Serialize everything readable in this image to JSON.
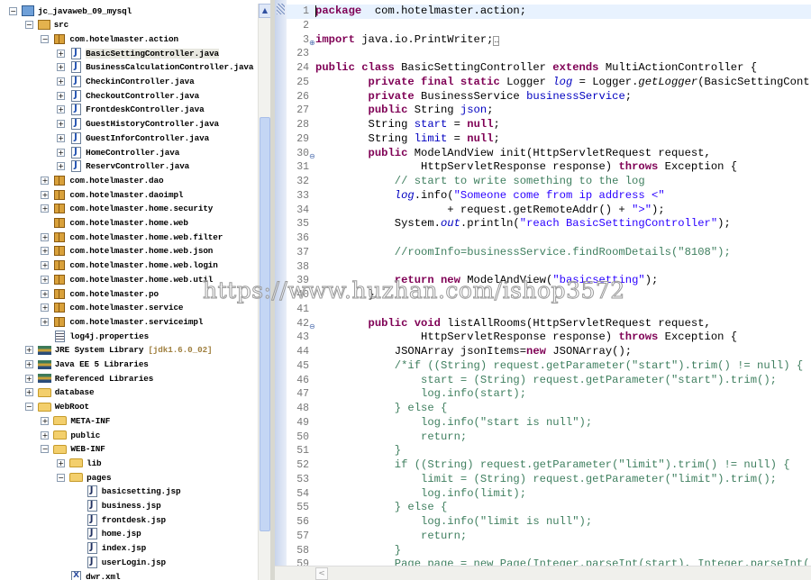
{
  "package_explorer": {
    "items": [
      {
        "level": 0,
        "expander": "-",
        "icon": "proj",
        "label": "jc_javaweb_09_mysql"
      },
      {
        "level": 1,
        "expander": "-",
        "icon": "src",
        "label": "src"
      },
      {
        "level": 2,
        "expander": "-",
        "icon": "pkg",
        "label": "com.hotelmaster.action"
      },
      {
        "level": 3,
        "expander": "+",
        "icon": "java",
        "label": "BasicSettingController.java",
        "selected": true
      },
      {
        "level": 3,
        "expander": "+",
        "icon": "java",
        "label": "BusinessCalculationController.java"
      },
      {
        "level": 3,
        "expander": "+",
        "icon": "java",
        "label": "CheckinController.java"
      },
      {
        "level": 3,
        "expander": "+",
        "icon": "java",
        "label": "CheckoutController.java"
      },
      {
        "level": 3,
        "expander": "+",
        "icon": "java",
        "label": "FrontdeskController.java"
      },
      {
        "level": 3,
        "expander": "+",
        "icon": "java",
        "label": "GuestHistoryController.java"
      },
      {
        "level": 3,
        "expander": "+",
        "icon": "java",
        "label": "GuestInforController.java"
      },
      {
        "level": 3,
        "expander": "+",
        "icon": "java",
        "label": "HomeController.java"
      },
      {
        "level": 3,
        "expander": "+",
        "icon": "java",
        "label": "ReservController.java"
      },
      {
        "level": 2,
        "expander": "+",
        "icon": "pkg",
        "label": "com.hotelmaster.dao"
      },
      {
        "level": 2,
        "expander": "+",
        "icon": "pkg",
        "label": "com.hotelmaster.daoimpl"
      },
      {
        "level": 2,
        "expander": "+",
        "icon": "pkg",
        "label": "com.hotelmaster.home.security"
      },
      {
        "level": 2,
        "expander": "",
        "icon": "pkg",
        "label": "com.hotelmaster.home.web"
      },
      {
        "level": 2,
        "expander": "+",
        "icon": "pkg",
        "label": "com.hotelmaster.home.web.filter"
      },
      {
        "level": 2,
        "expander": "+",
        "icon": "pkg",
        "label": "com.hotelmaster.home.web.json"
      },
      {
        "level": 2,
        "expander": "+",
        "icon": "pkg",
        "label": "com.hotelmaster.home.web.login"
      },
      {
        "level": 2,
        "expander": "+",
        "icon": "pkg",
        "label": "com.hotelmaster.home.web.util"
      },
      {
        "level": 2,
        "expander": "+",
        "icon": "pkg",
        "label": "com.hotelmaster.po"
      },
      {
        "level": 2,
        "expander": "+",
        "icon": "pkg",
        "label": "com.hotelmaster.service"
      },
      {
        "level": 2,
        "expander": "+",
        "icon": "pkg",
        "label": "com.hotelmaster.serviceimpl"
      },
      {
        "level": 2,
        "expander": "",
        "icon": "props",
        "label": "log4j.properties"
      },
      {
        "level": 1,
        "expander": "+",
        "icon": "lib",
        "label": "JRE System Library",
        "decoration": "[jdk1.6.0_02]"
      },
      {
        "level": 1,
        "expander": "+",
        "icon": "lib",
        "label": "Java EE 5 Libraries"
      },
      {
        "level": 1,
        "expander": "+",
        "icon": "lib",
        "label": "Referenced Libraries"
      },
      {
        "level": 1,
        "expander": "+",
        "icon": "folder",
        "label": "database"
      },
      {
        "level": 1,
        "expander": "-",
        "icon": "folder",
        "label": "WebRoot"
      },
      {
        "level": 2,
        "expander": "+",
        "icon": "folder",
        "label": "META-INF"
      },
      {
        "level": 2,
        "expander": "+",
        "icon": "folder",
        "label": "public"
      },
      {
        "level": 2,
        "expander": "-",
        "icon": "folder",
        "label": "WEB-INF"
      },
      {
        "level": 3,
        "expander": "+",
        "icon": "folder",
        "label": "lib"
      },
      {
        "level": 3,
        "expander": "-",
        "icon": "folder",
        "label": "pages"
      },
      {
        "level": 4,
        "expander": "",
        "icon": "jsp",
        "label": "basicsetting.jsp"
      },
      {
        "level": 4,
        "expander": "",
        "icon": "jsp",
        "label": "business.jsp"
      },
      {
        "level": 4,
        "expander": "",
        "icon": "jsp",
        "label": "frontdesk.jsp"
      },
      {
        "level": 4,
        "expander": "",
        "icon": "jsp",
        "label": "home.jsp"
      },
      {
        "level": 4,
        "expander": "",
        "icon": "jsp",
        "label": "index.jsp"
      },
      {
        "level": 4,
        "expander": "",
        "icon": "jsp",
        "label": "userLogin.jsp"
      },
      {
        "level": 3,
        "expander": "",
        "icon": "xml",
        "label": "dwr.xml"
      }
    ]
  },
  "editor": {
    "lines": [
      {
        "n": "1",
        "cur": true,
        "t": [
          [
            "kw",
            "package"
          ],
          [
            "",
            "  com.hotelmaster.action;"
          ]
        ]
      },
      {
        "n": "2",
        "t": []
      },
      {
        "n": "3",
        "fold": "+",
        "t": [
          [
            "kw",
            "import"
          ],
          [
            "",
            " java.io.PrintWriter;"
          ],
          [
            "fb",
            "…"
          ]
        ]
      },
      {
        "n": "23",
        "t": []
      },
      {
        "n": "24",
        "t": [
          [
            "kw",
            "public class"
          ],
          [
            "",
            " BasicSettingController "
          ],
          [
            "kw",
            "extends"
          ],
          [
            "",
            " MultiActionController {"
          ]
        ]
      },
      {
        "n": "25",
        "t": [
          [
            "",
            "        "
          ],
          [
            "kw",
            "private final static"
          ],
          [
            "",
            " Logger "
          ],
          [
            "sfld",
            "log"
          ],
          [
            "",
            " = Logger."
          ],
          [
            "it",
            "getLogger"
          ],
          [
            "",
            "(BasicSettingController.class);"
          ]
        ]
      },
      {
        "n": "26",
        "t": [
          [
            "",
            "        "
          ],
          [
            "kw",
            "private"
          ],
          [
            "",
            " BusinessService "
          ],
          [
            "fld",
            "businessService"
          ],
          [
            "",
            ";"
          ]
        ]
      },
      {
        "n": "27",
        "t": [
          [
            "",
            "        "
          ],
          [
            "kw",
            "public"
          ],
          [
            "",
            " String "
          ],
          [
            "fld",
            "json"
          ],
          [
            "",
            ";"
          ]
        ]
      },
      {
        "n": "28",
        "t": [
          [
            "",
            "        String "
          ],
          [
            "fld",
            "start"
          ],
          [
            "",
            " = "
          ],
          [
            "kw",
            "null"
          ],
          [
            "",
            ";"
          ]
        ]
      },
      {
        "n": "29",
        "t": [
          [
            "",
            "        String "
          ],
          [
            "fld",
            "limit"
          ],
          [
            "",
            " = "
          ],
          [
            "kw",
            "null"
          ],
          [
            "",
            ";"
          ]
        ]
      },
      {
        "n": "30",
        "fold": "-",
        "t": [
          [
            "",
            "        "
          ],
          [
            "kw",
            "public"
          ],
          [
            "",
            " ModelAndView init(HttpServletRequest request,"
          ]
        ]
      },
      {
        "n": "31",
        "t": [
          [
            "",
            "                HttpServletResponse response) "
          ],
          [
            "kw",
            "throws"
          ],
          [
            "",
            " Exception {"
          ]
        ]
      },
      {
        "n": "32",
        "t": [
          [
            "",
            "            "
          ],
          [
            "com",
            "// start to write something to the log"
          ]
        ]
      },
      {
        "n": "33",
        "t": [
          [
            "",
            "            "
          ],
          [
            "sfld",
            "log"
          ],
          [
            "",
            ".info("
          ],
          [
            "str",
            "\"Someone come from ip address <\""
          ]
        ]
      },
      {
        "n": "34",
        "t": [
          [
            "",
            "                    + request.getRemoteAddr() + "
          ],
          [
            "str",
            "\">\""
          ],
          [
            "",
            ");"
          ]
        ]
      },
      {
        "n": "35",
        "t": [
          [
            "",
            "            System."
          ],
          [
            "sfld",
            "out"
          ],
          [
            "",
            ".println("
          ],
          [
            "str",
            "\"reach BasicSettingController\""
          ],
          [
            "",
            ");"
          ]
        ]
      },
      {
        "n": "36",
        "t": []
      },
      {
        "n": "37",
        "t": [
          [
            "",
            "            "
          ],
          [
            "com",
            "//roomInfo=businessService.findRoomDetails(\"8108\");"
          ]
        ]
      },
      {
        "n": "38",
        "t": []
      },
      {
        "n": "39",
        "t": [
          [
            "",
            "            "
          ],
          [
            "kw",
            "return new"
          ],
          [
            "",
            " ModelAndView("
          ],
          [
            "str",
            "\"basicsetting\""
          ],
          [
            "",
            ");"
          ]
        ]
      },
      {
        "n": "40",
        "t": [
          [
            "",
            "        }"
          ]
        ]
      },
      {
        "n": "41",
        "t": []
      },
      {
        "n": "42",
        "fold": "-",
        "t": [
          [
            "",
            "        "
          ],
          [
            "kw",
            "public void"
          ],
          [
            "",
            " listAllRooms(HttpServletRequest request,"
          ]
        ]
      },
      {
        "n": "43",
        "t": [
          [
            "",
            "                HttpServletResponse response) "
          ],
          [
            "kw",
            "throws"
          ],
          [
            "",
            " Exception {"
          ]
        ]
      },
      {
        "n": "44",
        "t": [
          [
            "",
            "            JSONArray jsonItems="
          ],
          [
            "kw",
            "new"
          ],
          [
            "",
            " JSONArray();"
          ]
        ]
      },
      {
        "n": "45",
        "t": [
          [
            "",
            "            "
          ],
          [
            "com",
            "/*if ((String) request.getParameter(\"start\").trim() != null) {"
          ]
        ]
      },
      {
        "n": "46",
        "t": [
          [
            "",
            "                "
          ],
          [
            "com",
            "start = (String) request.getParameter(\"start\").trim();"
          ]
        ]
      },
      {
        "n": "47",
        "t": [
          [
            "",
            "                "
          ],
          [
            "com",
            "log.info(start);"
          ]
        ]
      },
      {
        "n": "48",
        "t": [
          [
            "",
            "            "
          ],
          [
            "com",
            "} else {"
          ]
        ]
      },
      {
        "n": "49",
        "t": [
          [
            "",
            "                "
          ],
          [
            "com",
            "log.info(\"start is null\");"
          ]
        ]
      },
      {
        "n": "50",
        "t": [
          [
            "",
            "                "
          ],
          [
            "com",
            "return;"
          ]
        ]
      },
      {
        "n": "51",
        "t": [
          [
            "",
            "            "
          ],
          [
            "com",
            "}"
          ]
        ]
      },
      {
        "n": "52",
        "t": [
          [
            "",
            "            "
          ],
          [
            "com",
            "if ((String) request.getParameter(\"limit\").trim() != null) {"
          ]
        ]
      },
      {
        "n": "53",
        "t": [
          [
            "",
            "                "
          ],
          [
            "com",
            "limit = (String) request.getParameter(\"limit\").trim();"
          ]
        ]
      },
      {
        "n": "54",
        "t": [
          [
            "",
            "                "
          ],
          [
            "com",
            "log.info(limit);"
          ]
        ]
      },
      {
        "n": "55",
        "t": [
          [
            "",
            "            "
          ],
          [
            "com",
            "} else {"
          ]
        ]
      },
      {
        "n": "56",
        "t": [
          [
            "",
            "                "
          ],
          [
            "com",
            "log.info(\"limit is null\");"
          ]
        ]
      },
      {
        "n": "57",
        "t": [
          [
            "",
            "                "
          ],
          [
            "com",
            "return;"
          ]
        ]
      },
      {
        "n": "58",
        "t": [
          [
            "",
            "            "
          ],
          [
            "com",
            "}"
          ]
        ]
      },
      {
        "n": "59",
        "t": [
          [
            "",
            "            "
          ],
          [
            "com",
            "Page page = new Page(Integer.parseInt(start), Integer.parseInt(limit));"
          ]
        ]
      }
    ]
  },
  "watermark": "https://www.huzhan.com/ishop3572",
  "colors": {
    "keyword": "#7f0055",
    "field": "#0000c0",
    "string": "#2a00ff",
    "comment": "#3f7f5f",
    "current_line": "#e8f2fe"
  }
}
